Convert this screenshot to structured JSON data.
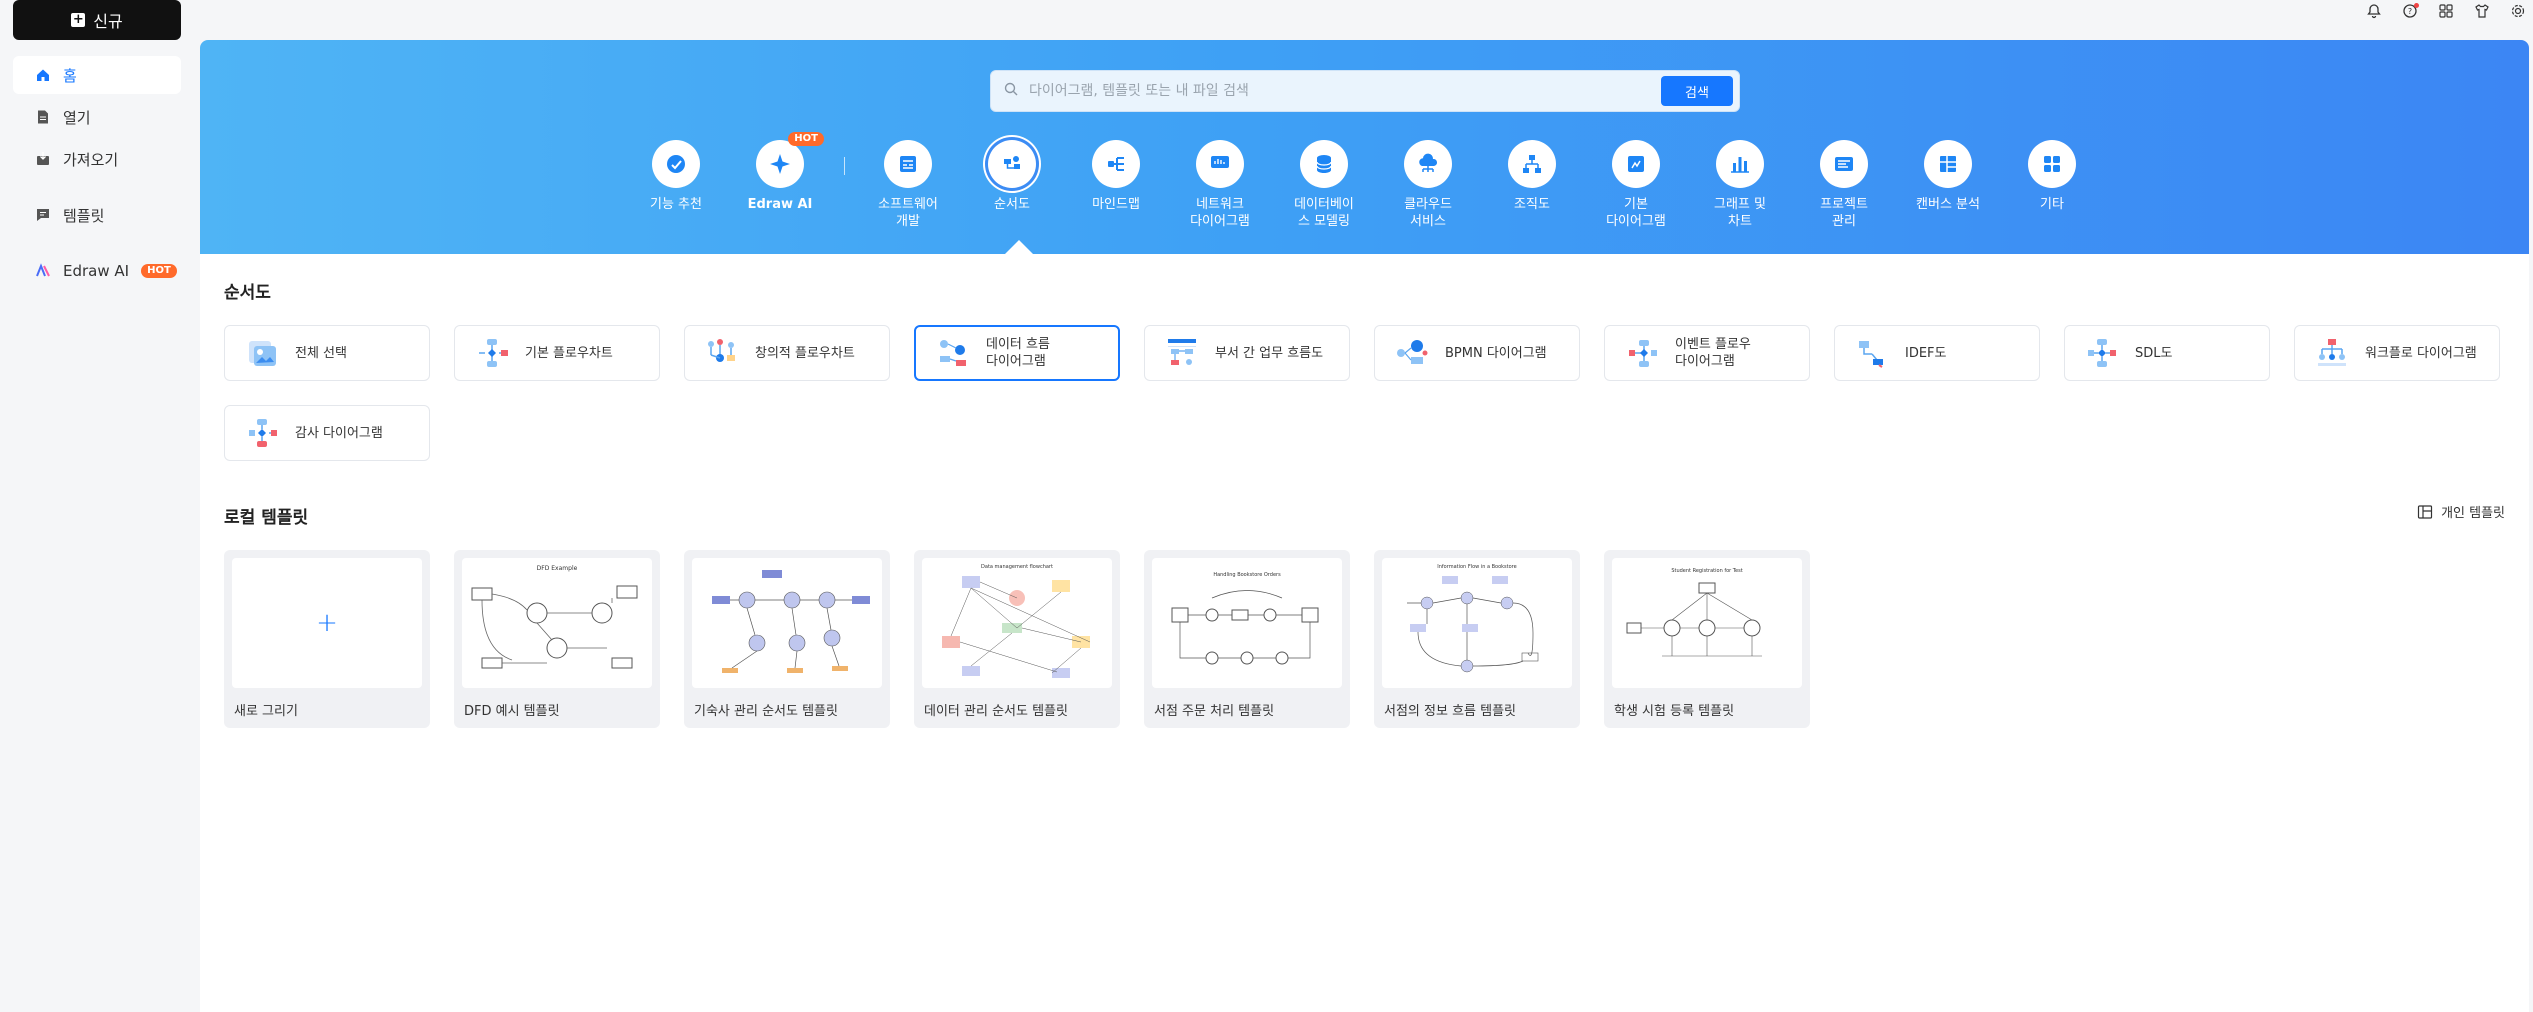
{
  "sidebar": {
    "new_label": "신규",
    "items": [
      {
        "label": "홈",
        "icon": "home-icon"
      },
      {
        "label": "열기",
        "icon": "file-icon"
      },
      {
        "label": "가져오기",
        "icon": "import-icon"
      },
      {
        "label": "템플릿",
        "icon": "template-icon"
      },
      {
        "label": "Edraw AI",
        "icon": "edraw-ai-icon",
        "badge": "HOT"
      }
    ]
  },
  "search": {
    "placeholder": "다이어그램, 템플릿 또는 내 파일 검색",
    "button": "검색"
  },
  "categories": [
    {
      "label": "기능 추천",
      "icon": "recommend-icon"
    },
    {
      "label": "Edraw AI",
      "icon": "ai-sparkle-icon",
      "badge": "HOT"
    },
    {
      "label": "소프트웨어\n개발",
      "icon": "software-icon"
    },
    {
      "label": "순서도",
      "icon": "flowchart-icon",
      "selected": true
    },
    {
      "label": "마인드맵",
      "icon": "mindmap-icon"
    },
    {
      "label": "네트워크\n다이어그램",
      "icon": "network-icon"
    },
    {
      "label": "데이터베이\n스 모델링",
      "icon": "database-icon"
    },
    {
      "label": "클라우드\n서비스",
      "icon": "cloud-icon"
    },
    {
      "label": "조직도",
      "icon": "orgchart-icon"
    },
    {
      "label": "기본\n다이어그램",
      "icon": "basic-diagram-icon"
    },
    {
      "label": "그래프 및\n차트",
      "icon": "chart-icon"
    },
    {
      "label": "프로젝트\n관리",
      "icon": "project-icon"
    },
    {
      "label": "캔버스 분석",
      "icon": "canvas-icon"
    },
    {
      "label": "기타",
      "icon": "more-icon"
    }
  ],
  "section_title": "순서도",
  "diagram_types": [
    {
      "label": "전체 선택",
      "icon": "all-select-icon"
    },
    {
      "label": "기본 플로우차트",
      "icon": "basic-flowchart-icon"
    },
    {
      "label": "창의적 플로우차트",
      "icon": "creative-flowchart-icon"
    },
    {
      "label": "데이터 흐름\n다이어그램",
      "icon": "data-flow-icon",
      "selected": true
    },
    {
      "label": "부서 간 업무 흐름도",
      "icon": "cross-functional-icon"
    },
    {
      "label": "BPMN 다이어그램",
      "icon": "bpmn-icon"
    },
    {
      "label": "이벤트 플로우\n다이어그램",
      "icon": "event-flow-icon"
    },
    {
      "label": "IDEF도",
      "icon": "idef-icon"
    },
    {
      "label": "SDL도",
      "icon": "sdl-icon"
    },
    {
      "label": "워크플로 다이어그램",
      "icon": "workflow-icon"
    },
    {
      "label": "감사 다이어그램",
      "icon": "audit-icon"
    }
  ],
  "local_templates_title": "로컬 템플릿",
  "personal_templates_label": "개인 템플릿",
  "templates": [
    {
      "label": "새로 그리기",
      "kind": "new"
    },
    {
      "label": "DFD 예시 템플릿",
      "thumb_title": "DFD Example"
    },
    {
      "label": "기숙사 관리 순서도 템플릿",
      "thumb_title": ""
    },
    {
      "label": "데이터 관리 순서도 템플릿",
      "thumb_title": "Data management flowchart"
    },
    {
      "label": "서점 주문 처리 템플릿",
      "thumb_title": "Handling Bookstore Orders"
    },
    {
      "label": "서점의 정보 흐름 템플릿",
      "thumb_title": "Information Flow in a Bookstore"
    },
    {
      "label": "학생 시험 등록 템플릿",
      "thumb_title": "Student Registration for Test"
    }
  ],
  "colors": {
    "accent": "#1677ff",
    "hero_start": "#4fb4f5",
    "hero_end": "#3c86f4",
    "hot": "#ff6a2b"
  }
}
